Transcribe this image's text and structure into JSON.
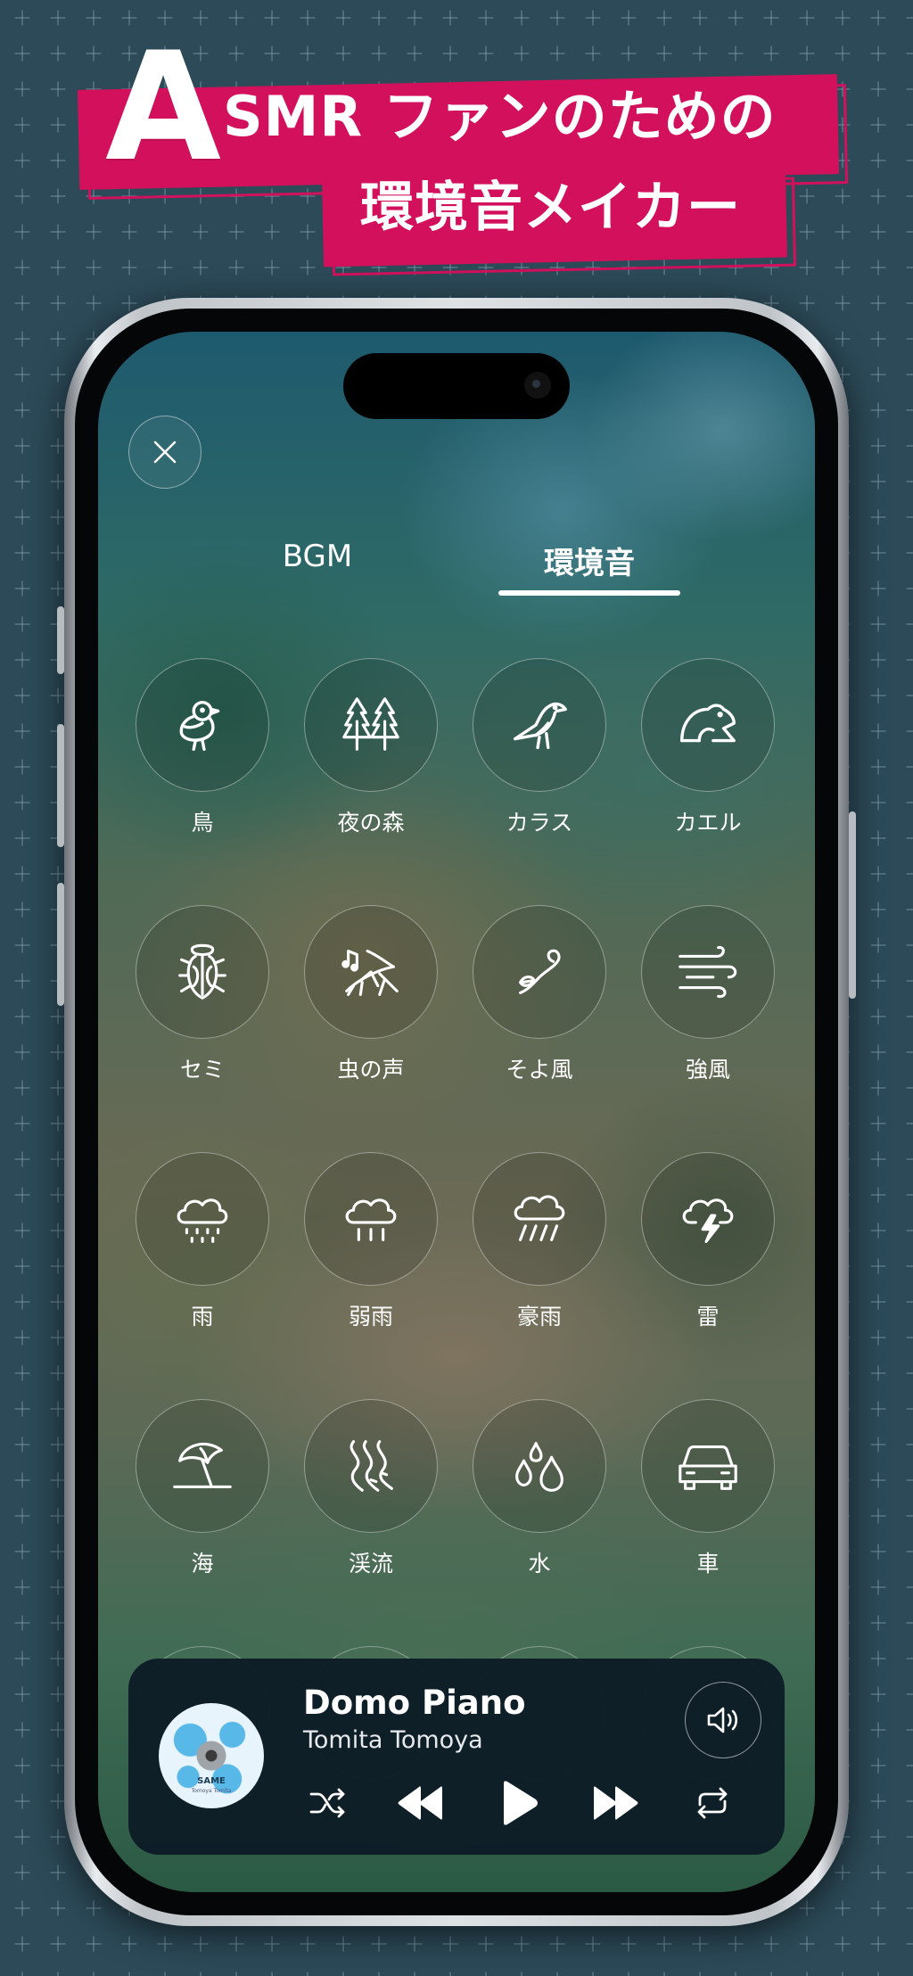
{
  "headline": {
    "big_letter": "A",
    "line1": "SMR ファンのための",
    "line2": "環境音メイカー"
  },
  "colors": {
    "banner": "#d3105c",
    "background": "#0f2430",
    "player": "#0c1c26"
  },
  "tabs": [
    {
      "label": "BGM",
      "active": false
    },
    {
      "label": "環境音",
      "active": true
    }
  ],
  "close_icon": "close-icon",
  "sounds": [
    {
      "label": "鳥",
      "icon": "bird-icon"
    },
    {
      "label": "夜の森",
      "icon": "forest-icon"
    },
    {
      "label": "カラス",
      "icon": "crow-icon"
    },
    {
      "label": "カエル",
      "icon": "frog-icon"
    },
    {
      "label": "セミ",
      "icon": "cicada-icon"
    },
    {
      "label": "虫の声",
      "icon": "cricket-icon"
    },
    {
      "label": "そよ風",
      "icon": "breeze-icon"
    },
    {
      "label": "強風",
      "icon": "strong-wind-icon"
    },
    {
      "label": "雨",
      "icon": "rain-icon"
    },
    {
      "label": "弱雨",
      "icon": "light-rain-icon"
    },
    {
      "label": "豪雨",
      "icon": "heavy-rain-icon"
    },
    {
      "label": "雷",
      "icon": "thunder-icon"
    },
    {
      "label": "海",
      "icon": "beach-umbrella-icon"
    },
    {
      "label": "渓流",
      "icon": "stream-icon"
    },
    {
      "label": "水",
      "icon": "water-drops-icon"
    },
    {
      "label": "車",
      "icon": "car-icon"
    }
  ],
  "player": {
    "title": "Domo Piano",
    "artist": "Tomita Tomoya",
    "album_art_text": "SAME",
    "album_art_subtext": "Tomoya Tomita",
    "controls": [
      "shuffle-icon",
      "previous-icon",
      "play-icon",
      "next-icon",
      "repeat-icon"
    ],
    "volume_icon": "speaker-icon"
  }
}
